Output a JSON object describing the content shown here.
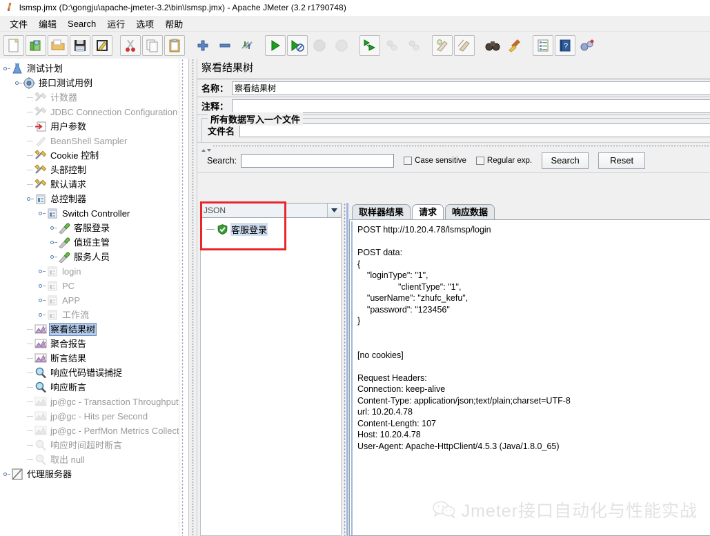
{
  "window": {
    "title": "lsmsp.jmx (D:\\gongju\\apache-jmeter-3.2\\bin\\lsmsp.jmx) - Apache JMeter (3.2 r1790748)",
    "icon": "jmeter-pen-icon"
  },
  "menubar": {
    "items": [
      {
        "label": "文件",
        "name": "menu-file"
      },
      {
        "label": "编辑",
        "name": "menu-edit"
      },
      {
        "label": "Search",
        "name": "menu-search"
      },
      {
        "label": "运行",
        "name": "menu-run"
      },
      {
        "label": "选项",
        "name": "menu-options"
      },
      {
        "label": "帮助",
        "name": "menu-help"
      }
    ]
  },
  "toolbar": {
    "buttons": [
      {
        "name": "new-icon",
        "glyph": "new",
        "enabled": true
      },
      {
        "name": "templates-icon",
        "glyph": "templates",
        "enabled": true
      },
      {
        "name": "open-icon",
        "glyph": "open",
        "enabled": true
      },
      {
        "name": "save-icon",
        "glyph": "save",
        "enabled": true
      },
      {
        "name": "save-as-icon",
        "glyph": "saveas",
        "enabled": true
      },
      {
        "name": "separator",
        "glyph": "sep",
        "enabled": true
      },
      {
        "name": "cut-icon",
        "glyph": "cut",
        "enabled": true
      },
      {
        "name": "copy-icon",
        "glyph": "copy",
        "enabled": true
      },
      {
        "name": "paste-icon",
        "glyph": "paste",
        "enabled": true
      },
      {
        "name": "separator",
        "glyph": "sep",
        "enabled": true
      },
      {
        "name": "expand-all-icon",
        "glyph": "plus",
        "enabled": true
      },
      {
        "name": "collapse-all-icon",
        "glyph": "minus",
        "enabled": true
      },
      {
        "name": "toggle-icon",
        "glyph": "toggle",
        "enabled": true
      },
      {
        "name": "separator",
        "glyph": "sep",
        "enabled": true
      },
      {
        "name": "start-icon",
        "glyph": "start",
        "enabled": true
      },
      {
        "name": "start-no-pauses-icon",
        "glyph": "startnopause",
        "enabled": true
      },
      {
        "name": "stop-icon",
        "glyph": "stop",
        "enabled": false
      },
      {
        "name": "shutdown-icon",
        "glyph": "shutdown",
        "enabled": false
      },
      {
        "name": "separator",
        "glyph": "sep",
        "enabled": true
      },
      {
        "name": "remote-start-all-icon",
        "glyph": "remotestart",
        "enabled": true
      },
      {
        "name": "remote-stop-all-icon",
        "glyph": "remotestop",
        "enabled": false
      },
      {
        "name": "remote-shutdown-all-icon",
        "glyph": "remoteshutdown",
        "enabled": false
      },
      {
        "name": "separator",
        "glyph": "sep",
        "enabled": true
      },
      {
        "name": "clear-icon",
        "glyph": "clear",
        "enabled": true
      },
      {
        "name": "clear-all-icon",
        "glyph": "clearall",
        "enabled": true
      },
      {
        "name": "separator",
        "glyph": "sep",
        "enabled": true
      },
      {
        "name": "search-icon",
        "glyph": "binocular",
        "enabled": true
      },
      {
        "name": "reset-search-icon",
        "glyph": "broom",
        "enabled": true
      },
      {
        "name": "separator",
        "glyph": "sep",
        "enabled": true
      },
      {
        "name": "function-helper-icon",
        "glyph": "list",
        "enabled": true
      },
      {
        "name": "help-icon",
        "glyph": "help",
        "enabled": true
      },
      {
        "name": "undo-redo-icon",
        "glyph": "bugs",
        "enabled": true
      }
    ]
  },
  "tree": {
    "nodes": [
      {
        "label": "测试计划",
        "depth": 0,
        "icon": "flask-icon",
        "expandable": true,
        "dim": false,
        "selected": false
      },
      {
        "label": "接口测试用例",
        "depth": 1,
        "icon": "thread-group-icon",
        "expandable": true,
        "dim": false,
        "selected": false
      },
      {
        "label": "计数器",
        "depth": 2,
        "icon": "config-icon",
        "expandable": false,
        "dim": true,
        "selected": false
      },
      {
        "label": "JDBC Connection Configuration",
        "depth": 2,
        "icon": "config-icon",
        "expandable": false,
        "dim": true,
        "selected": false
      },
      {
        "label": "用户参数",
        "depth": 2,
        "icon": "preproc-icon",
        "expandable": false,
        "dim": false,
        "selected": false
      },
      {
        "label": "BeanShell Sampler",
        "depth": 2,
        "icon": "sampler-icon",
        "expandable": false,
        "dim": true,
        "selected": false
      },
      {
        "label": "Cookie 控制",
        "depth": 2,
        "icon": "config-icon",
        "expandable": false,
        "dim": false,
        "selected": false
      },
      {
        "label": "头部控制",
        "depth": 2,
        "icon": "config-icon",
        "expandable": false,
        "dim": false,
        "selected": false
      },
      {
        "label": "默认请求",
        "depth": 2,
        "icon": "config-icon",
        "expandable": false,
        "dim": false,
        "selected": false
      },
      {
        "label": "总控制器",
        "depth": 2,
        "icon": "controller-icon",
        "expandable": true,
        "dim": false,
        "selected": false
      },
      {
        "label": "Switch Controller",
        "depth": 3,
        "icon": "controller-icon",
        "expandable": true,
        "dim": false,
        "selected": false
      },
      {
        "label": "客服登录",
        "depth": 4,
        "icon": "http-sampler-icon",
        "expandable": true,
        "dim": false,
        "selected": false
      },
      {
        "label": "值班主管",
        "depth": 4,
        "icon": "http-sampler-icon",
        "expandable": true,
        "dim": false,
        "selected": false
      },
      {
        "label": "服务人员",
        "depth": 4,
        "icon": "http-sampler-icon",
        "expandable": true,
        "dim": false,
        "selected": false
      },
      {
        "label": "login",
        "depth": 3,
        "icon": "controller-icon",
        "expandable": true,
        "dim": true,
        "selected": false
      },
      {
        "label": "PC",
        "depth": 3,
        "icon": "controller-icon",
        "expandable": true,
        "dim": true,
        "selected": false
      },
      {
        "label": "APP",
        "depth": 3,
        "icon": "controller-icon",
        "expandable": true,
        "dim": true,
        "selected": false
      },
      {
        "label": "工作流",
        "depth": 3,
        "icon": "controller-icon",
        "expandable": true,
        "dim": true,
        "selected": false
      },
      {
        "label": "察看结果树",
        "depth": 2,
        "icon": "listener-icon",
        "expandable": false,
        "dim": false,
        "selected": true
      },
      {
        "label": "聚合报告",
        "depth": 2,
        "icon": "listener-icon",
        "expandable": false,
        "dim": false,
        "selected": false
      },
      {
        "label": "断言结果",
        "depth": 2,
        "icon": "listener-icon",
        "expandable": false,
        "dim": false,
        "selected": false
      },
      {
        "label": "响应代码错误捕捉",
        "depth": 2,
        "icon": "postproc-icon",
        "expandable": false,
        "dim": false,
        "selected": false
      },
      {
        "label": "响应断言",
        "depth": 2,
        "icon": "postproc-icon",
        "expandable": false,
        "dim": false,
        "selected": false
      },
      {
        "label": "jp@gc - Transaction Throughput vs",
        "depth": 2,
        "icon": "listener-gray-icon",
        "expandable": false,
        "dim": true,
        "selected": false
      },
      {
        "label": "jp@gc - Hits per Second",
        "depth": 2,
        "icon": "listener-gray-icon",
        "expandable": false,
        "dim": true,
        "selected": false
      },
      {
        "label": "jp@gc - PerfMon Metrics Collector",
        "depth": 2,
        "icon": "listener-gray-icon",
        "expandable": false,
        "dim": true,
        "selected": false
      },
      {
        "label": "响应时间超时断言",
        "depth": 2,
        "icon": "assertion-gray-icon",
        "expandable": false,
        "dim": true,
        "selected": false
      },
      {
        "label": "取出 null",
        "depth": 2,
        "icon": "assertion-gray-icon",
        "expandable": false,
        "dim": true,
        "selected": false
      },
      {
        "label": "代理服务器",
        "depth": 0,
        "icon": "workbench-icon",
        "expandable": true,
        "dim": false,
        "selected": false
      }
    ]
  },
  "panel": {
    "title": "察看结果树",
    "name_label": "名称：",
    "name_value": "察看结果树",
    "comment_label": "注释：",
    "comment_value": "",
    "group_title": "所有数据写入一个文件",
    "filename_label": "文件名",
    "filename_value": ""
  },
  "search": {
    "label": "Search:",
    "value": "",
    "case_sensitive_label": "Case sensitive",
    "case_sensitive_checked": false,
    "regular_exp_label": "Regular exp.",
    "regular_exp_checked": false,
    "search_button": "Search",
    "reset_button": "Reset"
  },
  "results": {
    "renderer_selected": "JSON",
    "items": [
      {
        "label": "客服登录",
        "status": "success"
      }
    ]
  },
  "tabs": [
    {
      "label": "取样器结果",
      "active": false,
      "name": "tab-sampler-result"
    },
    {
      "label": "请求",
      "active": true,
      "name": "tab-request"
    },
    {
      "label": "响应数据",
      "active": false,
      "name": "tab-response-data"
    }
  ],
  "request_text": "POST http://10.20.4.78/lsmsp/login\n\nPOST data:\n{\n    \"loginType\": \"1\",\n                 \"clientType\": \"1\",\n    \"userName\": \"zhufc_kefu\",\n    \"password\": \"123456\"\n}\n\n\n[no cookies]\n\nRequest Headers:\nConnection: keep-alive\nContent-Type: application/json;text/plain;charset=UTF-8\nurl: 10.20.4.78\nContent-Length: 107\nHost: 10.20.4.78\nUser-Agent: Apache-HttpClient/4.5.3 (Java/1.8.0_65)",
  "watermark": {
    "text": "Jmeter接口自动化与性能实战",
    "icon": "wechat-icon"
  },
  "colors": {
    "accent_red": "#e8262a",
    "selection_blue": "#b5ccec",
    "panel_bg": "#f0f0f0"
  }
}
